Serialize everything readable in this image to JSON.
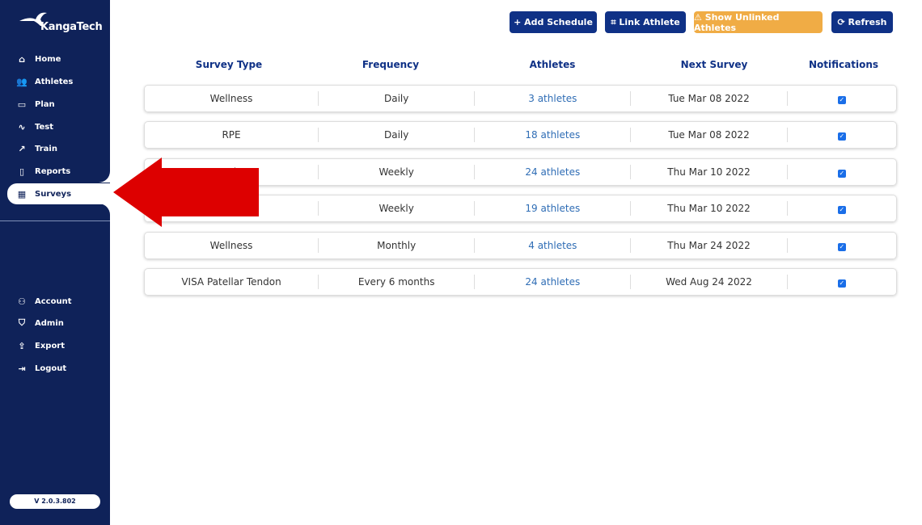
{
  "brand": "KangaTech",
  "sidebar": {
    "items": [
      {
        "label": "Home",
        "icon": "home-icon",
        "glyph": "⌂"
      },
      {
        "label": "Athletes",
        "icon": "users-icon",
        "glyph": "👥"
      },
      {
        "label": "Plan",
        "icon": "calendar-icon",
        "glyph": "▭"
      },
      {
        "label": "Test",
        "icon": "pulse-icon",
        "glyph": "∿"
      },
      {
        "label": "Train",
        "icon": "trend-icon",
        "glyph": "↗"
      },
      {
        "label": "Reports",
        "icon": "clipboard-icon",
        "glyph": "▯"
      },
      {
        "label": "Surveys",
        "icon": "survey-calendar-icon",
        "glyph": "▦"
      }
    ],
    "bottom_items": [
      {
        "label": "Account",
        "icon": "user-icon",
        "glyph": "⚇"
      },
      {
        "label": "Admin",
        "icon": "shield-icon",
        "glyph": "⛉"
      },
      {
        "label": "Export",
        "icon": "export-icon",
        "glyph": "⇪"
      },
      {
        "label": "Logout",
        "icon": "logout-icon",
        "glyph": "⇥"
      }
    ],
    "version": "V 2.0.3.802"
  },
  "toolbar": {
    "add": "+ Add Schedule",
    "link": "⌗ Link Athlete",
    "unlinked": "⚠ Show Unlinked Athletes",
    "refresh": "⟳ Refresh"
  },
  "colors": {
    "sidebar": "#0f2259",
    "primary": "#0f3186",
    "warning": "#f0ac45",
    "link": "#2f6db5",
    "arrow": "#dd0000"
  },
  "table": {
    "headers": [
      "Survey Type",
      "Frequency",
      "Athletes",
      "Next Survey",
      "Notifications"
    ],
    "rows": [
      {
        "type": "Wellness",
        "freq": "Daily",
        "athletes": "3 athletes",
        "next": "Tue Mar 08 2022",
        "notify": true
      },
      {
        "type": "RPE",
        "freq": "Daily",
        "athletes": "18 athletes",
        "next": "Tue Mar 08 2022",
        "notify": true
      },
      {
        "type": "…ndon",
        "freq": "Weekly",
        "athletes": "24 athletes",
        "next": "Thu Mar 10 2022",
        "notify": true
      },
      {
        "type": "…ndon",
        "freq": "Weekly",
        "athletes": "19 athletes",
        "next": "Thu Mar 10 2022",
        "notify": true
      },
      {
        "type": "Wellness",
        "freq": "Monthly",
        "athletes": "4 athletes",
        "next": "Thu Mar 24 2022",
        "notify": true
      },
      {
        "type": "VISA Patellar Tendon",
        "freq": "Every 6 months",
        "athletes": "24 athletes",
        "next": "Wed Aug 24 2022",
        "notify": true
      }
    ]
  }
}
